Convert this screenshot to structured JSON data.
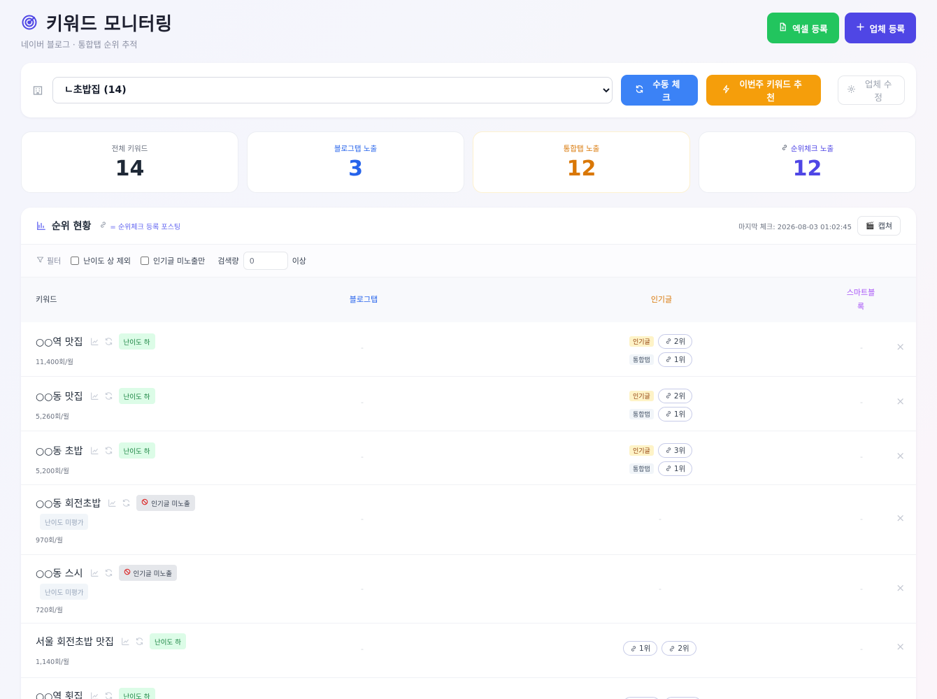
{
  "header": {
    "title": "키워드 모니터링",
    "subtitle": "네이버 블로그 · 통합탭 순위 추적",
    "excel_button": "엑셀 등록",
    "add_store_button": "업체 등록"
  },
  "toolbar": {
    "selected_store": "ㄴ초밥집 (14)",
    "manual_check": "수동 체크",
    "weekly_recommend": "이번주 키워드 추천",
    "edit_store": "업체 수정"
  },
  "stats": [
    {
      "label": "전체 키워드",
      "value": "14",
      "color": "#1f2937"
    },
    {
      "label": "블로그탭 노출",
      "value": "3",
      "color": "#2563eb"
    },
    {
      "label": "통합탭 노출",
      "value": "12",
      "color": "#d97706"
    },
    {
      "label": "순위체크 노출",
      "value": "12",
      "color": "#4f46e5"
    }
  ],
  "section": {
    "title": "순위 현황",
    "legend_note": "= 순위체크 등록 포스팅",
    "last_check": "마지막 체크: 2026-08-03 01:02:45",
    "capture": "캡쳐"
  },
  "filter": {
    "label": "필터",
    "exclude_hard": "난이도 상 제외",
    "popular_missing_only": "인기글 미노출만",
    "search_volume_label": "검색량",
    "search_volume_value": "0",
    "above": "이상"
  },
  "table": {
    "headers": {
      "keyword": "키워드",
      "blog_tab": "블로그탭",
      "popular": "인기글",
      "smart_block": "스마트블록"
    },
    "rows": [
      {
        "keyword": "○○역 맛집",
        "badge": "난이도 하",
        "volume": "11,400회/월",
        "blog": "-",
        "popular_tag": "인기글",
        "popular_rank": "2위",
        "integrated_tag": "통합탭",
        "integrated_rank": "1위",
        "smart": "-"
      },
      {
        "keyword": "○○동 맛집",
        "badge": "난이도 하",
        "volume": "5,260회/월",
        "blog": "-",
        "popular_tag": "인기글",
        "popular_rank": "2위",
        "integrated_tag": "통합탭",
        "integrated_rank": "1위",
        "smart": "-"
      },
      {
        "keyword": "○○동 초밥",
        "badge": "난이도 하",
        "volume": "5,200회/월",
        "blog": "-",
        "popular_tag": "인기글",
        "popular_rank": "3위",
        "integrated_tag": "통합탭",
        "integrated_rank": "1위",
        "smart": "-"
      },
      {
        "keyword": "○○동 회전초밥",
        "badge": "인기글 미노출",
        "sub_badge": "난이도 미평가",
        "volume": "970회/월",
        "blog": "-",
        "popular": "-",
        "smart": "-"
      },
      {
        "keyword": "○○동 스시",
        "badge": "인기글 미노출",
        "sub_badge": "난이도 미평가",
        "volume": "720회/월",
        "blog": "-",
        "popular": "-",
        "smart": "-"
      },
      {
        "keyword": "서울 회전초밥 맛집",
        "badge": "난이도 하",
        "volume": "1,140회/월",
        "blog": "-",
        "pill_a": "1위",
        "pill_b": "2위",
        "smart": "-"
      },
      {
        "keyword": "○○역 횟집",
        "badge": "난이도 하"
      }
    ],
    "remove_symbol": "×"
  },
  "colors": {
    "accent": "#4f46e5",
    "green": "#22c55e",
    "blue": "#3b82f6",
    "orange": "#f59e0b",
    "blog_header": "#2563eb",
    "popular_header": "#d97706",
    "smart_header": "#a855f7"
  }
}
